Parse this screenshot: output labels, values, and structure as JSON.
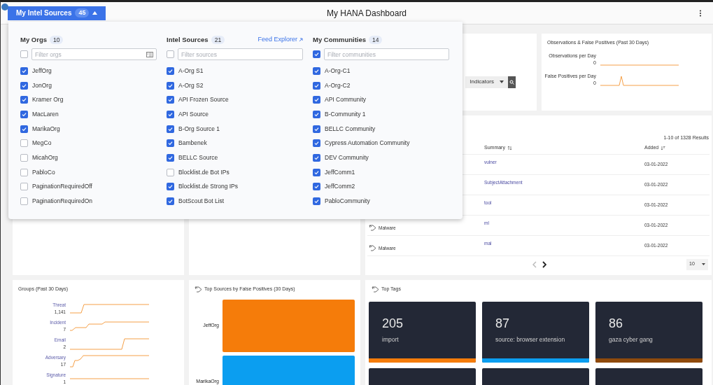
{
  "header": {
    "title": "My HANA Dashboard"
  },
  "sources_button": {
    "label": "My Intel Sources",
    "count": "45",
    "expanded": true
  },
  "sources_panel": {
    "columns": [
      {
        "title": "My Orgs",
        "count": "10",
        "filter": {
          "placeholder": "Filter orgs",
          "all_checked": false
        },
        "items": [
          {
            "label": "JeffOrg",
            "checked": true
          },
          {
            "label": "JonOrg",
            "checked": true
          },
          {
            "label": "Kramer Org",
            "checked": true
          },
          {
            "label": "MacLaren",
            "checked": true
          },
          {
            "label": "MarikaOrg",
            "checked": true
          },
          {
            "label": "MegCo",
            "checked": false
          },
          {
            "label": "MicahOrg",
            "checked": false
          },
          {
            "label": "PabloCo",
            "checked": false
          },
          {
            "label": "PaginationRequiredOff",
            "checked": false
          },
          {
            "label": "PaginationRequiredOn",
            "checked": false
          }
        ]
      },
      {
        "title": "Intel Sources",
        "count": "21",
        "link": "Feed Explorer",
        "filter": {
          "placeholder": "Filter sources",
          "all_checked": false
        },
        "items": [
          {
            "label": "A-Org S1",
            "checked": true
          },
          {
            "label": "A-Org S2",
            "checked": true
          },
          {
            "label": "API Frozen Source",
            "checked": true
          },
          {
            "label": "API Source",
            "checked": true
          },
          {
            "label": "B-Org Source 1",
            "checked": true
          },
          {
            "label": "Bambenek",
            "checked": true
          },
          {
            "label": "BELLC Source",
            "checked": true
          },
          {
            "label": "Blocklist.de Bot IPs",
            "checked": false
          },
          {
            "label": "Blocklist.de Strong IPs",
            "checked": true
          },
          {
            "label": "BotScout Bot List",
            "checked": true
          }
        ]
      },
      {
        "title": "My Communities",
        "count": "14",
        "filter": {
          "placeholder": "Filter communities",
          "all_checked": true
        },
        "items": [
          {
            "label": "A-Org-C1",
            "checked": true
          },
          {
            "label": "A-Org-C2",
            "checked": true
          },
          {
            "label": "API Community",
            "checked": true
          },
          {
            "label": "B-Community 1",
            "checked": true
          },
          {
            "label": "BELLC Community",
            "checked": true
          },
          {
            "label": "Cypress Automation Community",
            "checked": true
          },
          {
            "label": "DEV Community",
            "checked": true
          },
          {
            "label": "JeffComm1",
            "checked": true
          },
          {
            "label": "JeffComm2",
            "checked": true
          },
          {
            "label": "PabloCommunity",
            "checked": true
          }
        ]
      }
    ]
  },
  "search_card": {
    "type_select": "Indicators"
  },
  "observations_card": {
    "title": "Observations & False Positives (Past 30 Days)",
    "rows": [
      {
        "label": "Observations per Day",
        "value": "0"
      },
      {
        "label": "False Positives per Day",
        "value": "0"
      }
    ]
  },
  "results_table": {
    "results": "1-10 of 1328 Results",
    "columns": [
      "Summary",
      "Added"
    ],
    "rows": [
      {
        "summary": "vulner",
        "added": "03-01-2022"
      },
      {
        "summary": "SubjectAttachment",
        "added": "03-01-2022"
      },
      {
        "summary": "tool",
        "added": "03-01-2022"
      },
      {
        "type": "Malware",
        "summary": "ml",
        "added": "03-01-2022"
      },
      {
        "type": "Malware",
        "summary": "mal",
        "added": "03-01-2022"
      }
    ],
    "page_size": "10"
  },
  "groups_card": {
    "title": "Groups (Past 30 Days)",
    "rows": [
      {
        "label": "Threat",
        "value": "1,141"
      },
      {
        "label": "Incident",
        "value": "7"
      },
      {
        "label": "Email",
        "value": "2"
      },
      {
        "label": "Adversary",
        "value": "17"
      },
      {
        "label": "Signature",
        "value": "1"
      }
    ]
  },
  "top_sources_card": {
    "title": "Top Sources by False Positives (30 Days)",
    "bars": [
      {
        "label": "JeffOrg",
        "color": "#f57c0a"
      },
      {
        "label": "MarikaOrg",
        "color": "#0b9ef0"
      }
    ]
  },
  "top_tags_card": {
    "title": "Top Tags",
    "tiles": [
      {
        "kind": "tag",
        "count": "205",
        "name": "import",
        "color": "#f57c0a"
      },
      {
        "kind": "tag",
        "count": "87",
        "name": "source: browser extension",
        "color": "#0b9ef0"
      },
      {
        "kind": "tag",
        "count": "86",
        "name": "gaza cyber gang",
        "color": "#8f4a0c"
      },
      {
        "kind": "cut"
      },
      {
        "kind": "cut"
      },
      {
        "kind": "cut"
      }
    ]
  }
}
